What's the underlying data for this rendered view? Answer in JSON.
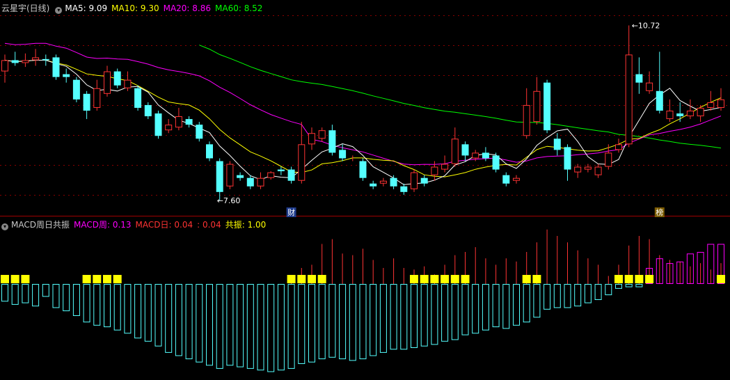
{
  "main_header": {
    "title": "云星宇(日线)",
    "indicators": [
      {
        "label": "MA5:",
        "value": "9.09",
        "color": "#ffffff"
      },
      {
        "label": "MA10:",
        "value": "9.30",
        "color": "#ffff00"
      },
      {
        "label": "MA20:",
        "value": "8.86",
        "color": "#ff00ff"
      },
      {
        "label": "MA60:",
        "value": "8.52",
        "color": "#00ff00"
      }
    ]
  },
  "sub_header": {
    "title": "MACD周日共振",
    "indicators": [
      {
        "label": "MACD周:",
        "value": "0.13",
        "color": "#ff00ff"
      },
      {
        "label": "MACD日:",
        "value": "0.04",
        "color": "#ff3333"
      },
      {
        "label": ":",
        "value": "0.04",
        "color": "#ff3333"
      },
      {
        "label": "共振:",
        "value": "1.00",
        "color": "#ffff00"
      }
    ]
  },
  "colors": {
    "up": "#ff3333",
    "down": "#54ffff",
    "ma5": "#ffffff",
    "ma10": "#ffff00",
    "ma20": "#ff00ff",
    "ma60": "#00ff00",
    "grid": "#8b0000",
    "signal": "#ffff00"
  },
  "chart_data": [
    {
      "type": "candlestick",
      "ylim": [
        7.45,
        10.9
      ],
      "low_label": "7.60",
      "high_label": "10.72",
      "markers": [
        {
          "index": 28,
          "label": "财"
        },
        {
          "index": 64,
          "label": "榜"
        }
      ],
      "candles": [
        [
          9.9,
          10.1,
          10.2,
          9.7
        ],
        [
          10.1,
          10.05,
          10.25,
          10.0
        ],
        [
          10.05,
          10.1,
          10.22,
          9.98
        ],
        [
          10.1,
          10.15,
          10.3,
          10.0
        ],
        [
          10.12,
          10.1,
          10.2,
          10.0
        ],
        [
          10.15,
          9.8,
          10.2,
          9.75
        ],
        [
          9.85,
          9.8,
          9.95,
          9.7
        ],
        [
          9.75,
          9.4,
          9.8,
          9.35
        ],
        [
          9.5,
          9.2,
          9.55,
          9.05
        ],
        [
          9.25,
          9.6,
          9.75,
          9.2
        ],
        [
          9.5,
          9.9,
          10.0,
          9.45
        ],
        [
          9.9,
          9.65,
          9.95,
          9.6
        ],
        [
          9.6,
          9.75,
          9.9,
          9.55
        ],
        [
          9.6,
          9.25,
          9.65,
          9.2
        ],
        [
          9.3,
          9.1,
          9.35,
          9.05
        ],
        [
          9.15,
          8.75,
          9.2,
          8.7
        ],
        [
          8.85,
          8.95,
          9.05,
          8.8
        ],
        [
          8.9,
          9.1,
          9.25,
          8.85
        ],
        [
          9.05,
          8.95,
          9.1,
          8.9
        ],
        [
          8.95,
          8.7,
          9.0,
          8.65
        ],
        [
          8.6,
          8.35,
          8.65,
          8.3
        ],
        [
          8.3,
          7.75,
          8.35,
          7.6
        ],
        [
          7.85,
          8.25,
          8.3,
          7.8
        ],
        [
          8.05,
          8.0,
          8.1,
          7.95
        ],
        [
          8.0,
          7.85,
          8.05,
          7.8
        ],
        [
          7.85,
          8.0,
          8.1,
          7.8
        ],
        [
          8.0,
          8.1,
          8.12,
          7.97
        ],
        [
          8.15,
          8.12,
          8.2,
          8.05
        ],
        [
          8.15,
          7.95,
          8.2,
          7.9
        ],
        [
          7.95,
          8.6,
          9.0,
          7.9
        ],
        [
          8.6,
          8.8,
          8.9,
          8.5
        ],
        [
          8.7,
          8.85,
          8.9,
          8.65
        ],
        [
          8.85,
          8.45,
          8.95,
          8.4
        ],
        [
          8.5,
          8.35,
          8.6,
          8.3
        ],
        [
          8.35,
          8.35,
          8.4,
          8.3
        ],
        [
          8.3,
          8.0,
          8.35,
          7.95
        ],
        [
          7.9,
          7.85,
          7.95,
          7.8
        ],
        [
          7.9,
          7.95,
          8.0,
          7.85
        ],
        [
          8.0,
          7.85,
          8.05,
          7.8
        ],
        [
          7.85,
          7.75,
          7.9,
          7.7
        ],
        [
          7.8,
          8.1,
          8.15,
          7.75
        ],
        [
          8.0,
          7.9,
          8.05,
          7.85
        ],
        [
          8.05,
          8.2,
          8.3,
          7.95
        ],
        [
          8.15,
          8.25,
          8.4,
          8.1
        ],
        [
          8.25,
          8.7,
          8.9,
          8.2
        ],
        [
          8.6,
          8.4,
          8.65,
          8.3
        ],
        [
          8.35,
          8.45,
          8.5,
          8.3
        ],
        [
          8.45,
          8.35,
          8.55,
          8.3
        ],
        [
          8.4,
          8.15,
          8.45,
          8.1
        ],
        [
          8.05,
          7.9,
          8.1,
          7.85
        ],
        [
          7.95,
          8.0,
          8.05,
          7.9
        ],
        [
          8.75,
          9.3,
          9.6,
          8.7
        ],
        [
          9.0,
          9.55,
          9.8,
          8.95
        ],
        [
          9.7,
          8.85,
          9.75,
          8.8
        ],
        [
          8.7,
          8.5,
          8.8,
          8.4
        ],
        [
          8.55,
          8.15,
          8.6,
          7.95
        ],
        [
          8.1,
          8.2,
          8.25,
          8.0
        ],
        [
          8.15,
          8.2,
          8.25,
          8.1
        ],
        [
          8.05,
          8.2,
          8.25,
          8.0
        ],
        [
          8.2,
          8.45,
          8.6,
          8.15
        ],
        [
          8.5,
          8.6,
          8.7,
          8.45
        ],
        [
          8.6,
          10.2,
          10.72,
          8.55
        ],
        [
          9.85,
          9.7,
          10.15,
          9.5
        ],
        [
          9.55,
          9.7,
          9.9,
          9.5
        ],
        [
          9.55,
          9.2,
          10.25,
          9.15
        ],
        [
          9.05,
          9.2,
          9.4,
          9.0
        ],
        [
          9.15,
          9.1,
          9.35,
          9.0
        ],
        [
          9.1,
          9.2,
          9.4,
          9.05
        ],
        [
          9.1,
          9.25,
          9.3,
          9.0
        ],
        [
          9.25,
          9.35,
          9.55,
          9.2
        ],
        [
          9.25,
          9.4,
          9.6,
          9.2
        ]
      ]
    },
    {
      "type": "bar",
      "signal_value": 1.0,
      "macd_day": [
        -0.11,
        -0.13,
        -0.12,
        -0.14,
        -0.08,
        -0.15,
        -0.17,
        -0.2,
        -0.24,
        -0.26,
        -0.27,
        -0.29,
        -0.31,
        -0.34,
        -0.36,
        -0.39,
        -0.43,
        -0.45,
        -0.47,
        -0.49,
        -0.51,
        -0.53,
        -0.51,
        -0.52,
        -0.53,
        -0.54,
        -0.55,
        -0.54,
        -0.53,
        -0.5,
        -0.49,
        -0.47,
        -0.46,
        -0.47,
        -0.48,
        -0.47,
        -0.45,
        -0.43,
        -0.41,
        -0.41,
        -0.4,
        -0.39,
        -0.38,
        -0.36,
        -0.35,
        -0.32,
        -0.31,
        -0.29,
        -0.27,
        -0.28,
        -0.26,
        -0.24,
        -0.21,
        -0.16,
        -0.15,
        -0.15,
        -0.14,
        -0.12,
        -0.1,
        -0.07,
        -0.03,
        -0.02,
        -0.02,
        0.1,
        0.16,
        0.13,
        0.14,
        0.19,
        0.2,
        0.25,
        0.25
      ],
      "macd_week": [
        0,
        0,
        0,
        0,
        0,
        0,
        0,
        0,
        0,
        0,
        0,
        0,
        0,
        0,
        0,
        0,
        0,
        0,
        0,
        0,
        0,
        0,
        0,
        0,
        0,
        0,
        0,
        0,
        0.05,
        0.1,
        0.12,
        0.25,
        0.28,
        0.19,
        0.18,
        0.22,
        0.15,
        0.1,
        0.16,
        0.1,
        0.09,
        0.11,
        0.06,
        0.12,
        0.18,
        0.2,
        0.23,
        0.16,
        0.12,
        0.16,
        0.14,
        0.2,
        0.26,
        0.34,
        0.3,
        0.26,
        0.21,
        0.16,
        0.12,
        0.05,
        0.12,
        0.24,
        0.3,
        0.28,
        0.18,
        0.15,
        0.14,
        0.11,
        0.13,
        0.09,
        0.13
      ],
      "signal": [
        1,
        1,
        1,
        0,
        0,
        0,
        0,
        0,
        1,
        1,
        1,
        1,
        0,
        0,
        0,
        0,
        0,
        0,
        0,
        0,
        0,
        0,
        0,
        0,
        0,
        0,
        0,
        0,
        1,
        1,
        1,
        1,
        0,
        0,
        0,
        0,
        0,
        0,
        0,
        0,
        1,
        1,
        1,
        1,
        1,
        1,
        0,
        0,
        0,
        0,
        0,
        1,
        1,
        0,
        0,
        0,
        0,
        0,
        0,
        0,
        1,
        1,
        1,
        1,
        0,
        0,
        0,
        0,
        0,
        0,
        1
      ]
    }
  ]
}
